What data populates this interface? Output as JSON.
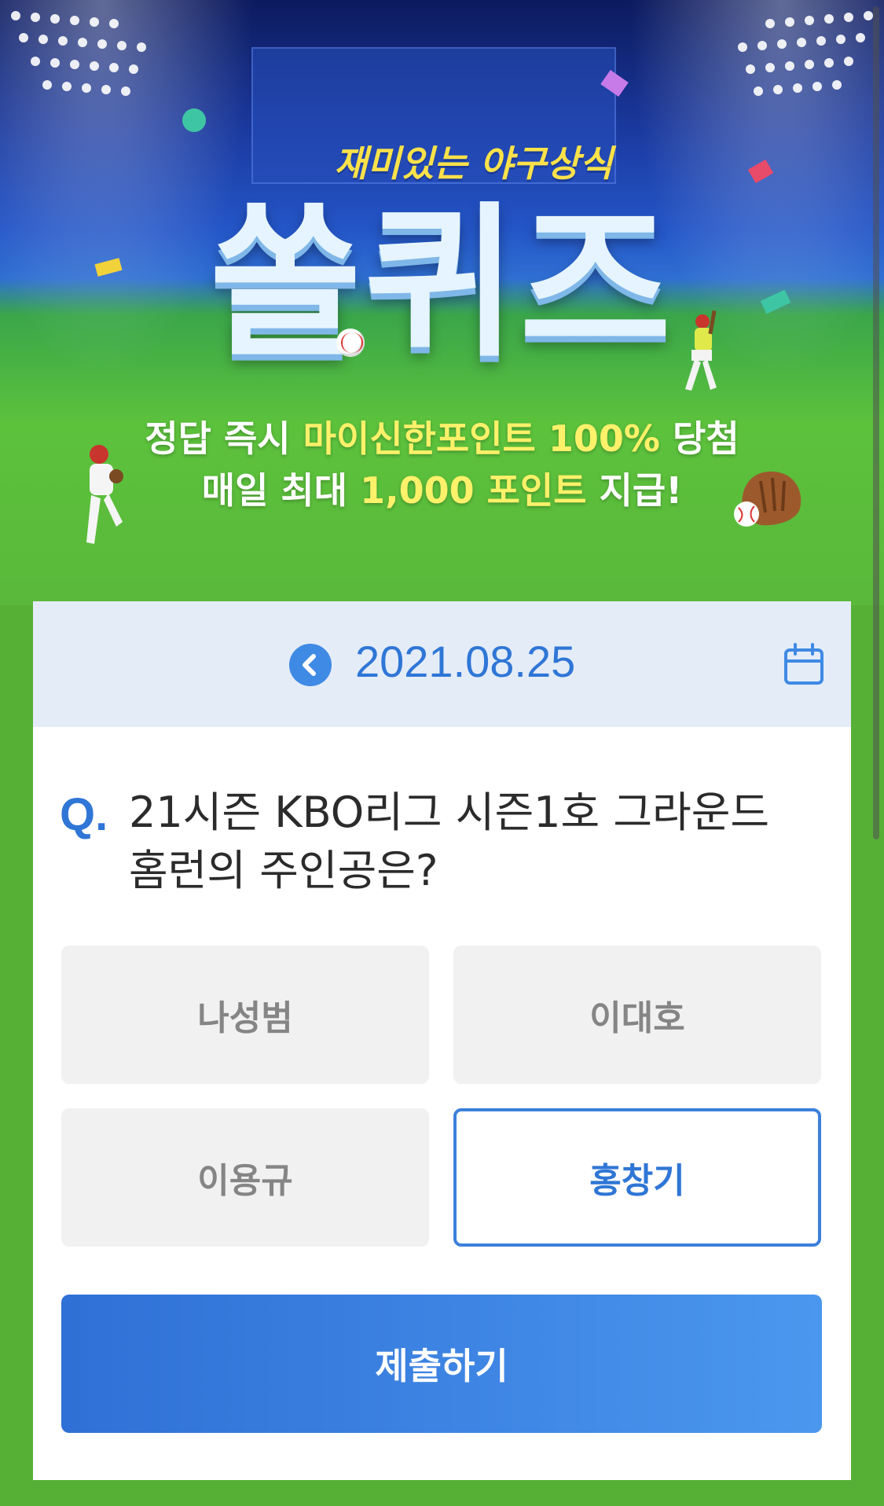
{
  "hero": {
    "subtitle": "재미있는 야구상식",
    "title": "쏠퀴즈",
    "line1_prefix": "정답 즉시 ",
    "line1_highlight": "마이신한포인트 100%",
    "line1_suffix": " 당첨",
    "line2_prefix": "매일 최대 ",
    "line2_highlight": "1,000 포인트",
    "line2_suffix": " 지급!"
  },
  "date_bar": {
    "date": "2021.08.25",
    "prev_icon": "chevron-left-icon",
    "calendar_icon": "calendar-icon"
  },
  "question": {
    "marker": "Q.",
    "line1": "21시즌 KBO리그 시즌1호 그라운드",
    "line2": "홈런의 주인공은?"
  },
  "options": [
    {
      "label": "나성범",
      "selected": false
    },
    {
      "label": "이대호",
      "selected": false
    },
    {
      "label": "이용규",
      "selected": false
    },
    {
      "label": "홍창기",
      "selected": true
    }
  ],
  "submit_label": "제출하기",
  "colors": {
    "accent": "#2f76d6",
    "background_green": "#57b036",
    "date_bar_bg": "#e4ecf8",
    "option_bg": "#f1f1f1",
    "highlight_yellow": "#fff16a"
  }
}
